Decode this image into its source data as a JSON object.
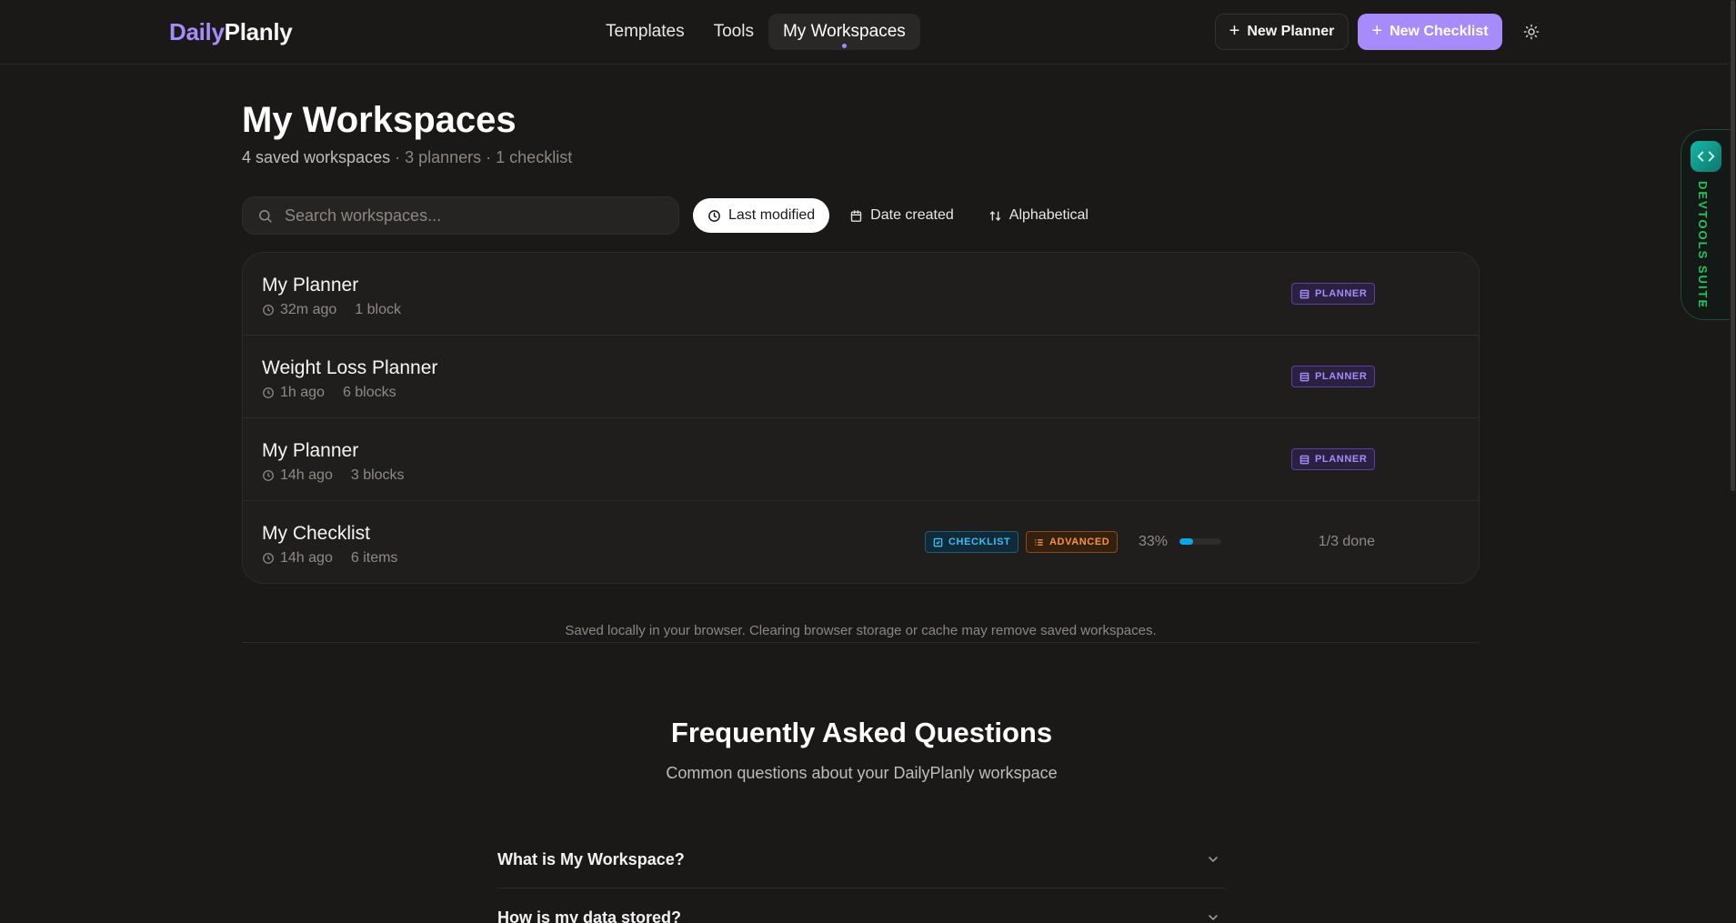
{
  "brand": {
    "part1": "Daily",
    "part2": "Planly"
  },
  "nav": {
    "items": [
      {
        "label": "Templates"
      },
      {
        "label": "Tools"
      },
      {
        "label": "My Workspaces"
      }
    ]
  },
  "header_actions": {
    "new_planner": "New Planner",
    "new_checklist": "New Checklist"
  },
  "page": {
    "title": "My Workspaces",
    "subtitle_main": "4 saved workspaces",
    "subtitle_meta": "· 3 planners · 1 checklist"
  },
  "search": {
    "placeholder": "Search workspaces..."
  },
  "sort": {
    "last_modified": "Last modified",
    "date_created": "Date created",
    "alphabetical": "Alphabetical"
  },
  "workspaces": [
    {
      "title": "My Planner",
      "time": "32m ago",
      "count": "1 block",
      "badge": "PLANNER"
    },
    {
      "title": "Weight Loss Planner",
      "time": "1h ago",
      "count": "6 blocks",
      "badge": "PLANNER"
    },
    {
      "title": "My Planner",
      "time": "14h ago",
      "count": "3 blocks",
      "badge": "PLANNER"
    },
    {
      "title": "My Checklist",
      "time": "14h ago",
      "count": "6 items",
      "badge": "CHECKLIST",
      "badge2": "ADVANCED",
      "progress_label": "33%",
      "progress": 0.33,
      "done": "1/3 done"
    }
  ],
  "storage_note": "Saved locally in your browser. Clearing browser storage or cache may remove saved workspaces.",
  "faq": {
    "title": "Frequently Asked Questions",
    "subtitle": "Common questions about your DailyPlanly workspace",
    "items": [
      {
        "q": "What is My Workspace?"
      },
      {
        "q": "How is my data stored?"
      }
    ]
  },
  "devtools": {
    "label": "DEVTOOLS SUITE"
  },
  "colors": {
    "accent": "#a78bfa",
    "background": "#1b1918",
    "checklist": "#38bdf8",
    "advanced": "#fb923c",
    "devtools": "#22c55e"
  }
}
